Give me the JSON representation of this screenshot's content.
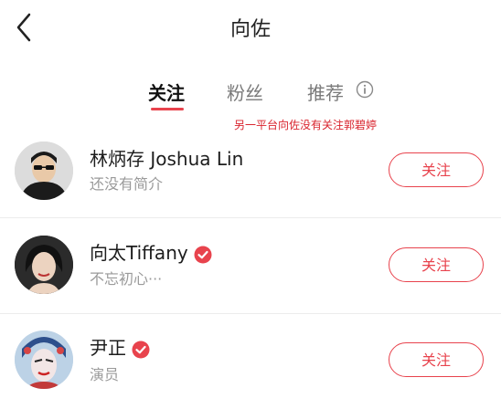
{
  "header": {
    "title": "向佐",
    "back_icon": "chevron-left-icon"
  },
  "tabs": [
    {
      "label": "关注",
      "active": true
    },
    {
      "label": "粉丝",
      "active": false
    },
    {
      "label": "推荐",
      "active": false,
      "icon": "info-icon"
    }
  ],
  "note": "另一平台向佐没有关注郭碧婷",
  "users": [
    {
      "name": "林炳存 Joshua Lin",
      "desc": "还没有简介",
      "verified": false,
      "follow_label": "关注"
    },
    {
      "name": "向太Tiffany",
      "desc": "不忘初心···",
      "verified": true,
      "follow_label": "关注"
    },
    {
      "name": "尹正",
      "desc": "演员",
      "verified": true,
      "follow_label": "关注"
    }
  ],
  "colors": {
    "accent": "#e8434d",
    "note": "#d9242e"
  }
}
